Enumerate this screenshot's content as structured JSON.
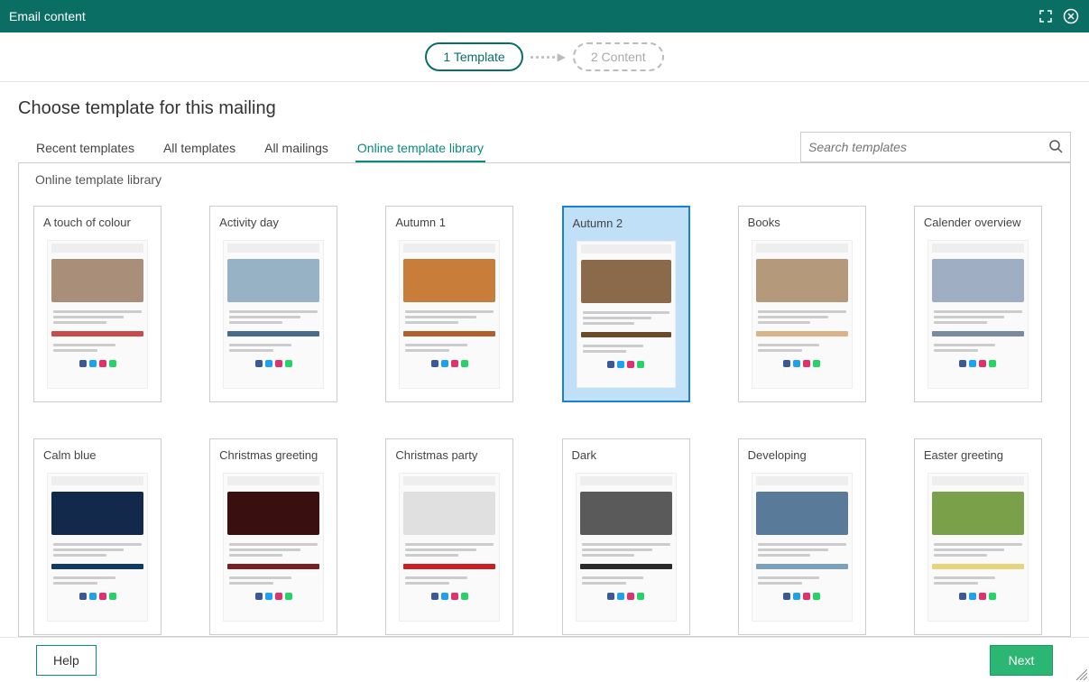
{
  "titlebar": {
    "title": "Email content"
  },
  "wizard": {
    "step1": "1 Template",
    "step2": "2 Content"
  },
  "heading": "Choose template for this mailing",
  "tabs": [
    "Recent templates",
    "All templates",
    "All mailings",
    "Online template library"
  ],
  "active_tab_index": 3,
  "search": {
    "placeholder": "Search templates"
  },
  "panel": {
    "header": "Online template library"
  },
  "templates": [
    {
      "name": "A touch of colour",
      "accent": "#c84b4b",
      "img": "#a98f7a",
      "selected": false
    },
    {
      "name": "Activity day",
      "accent": "#4a6a8a",
      "img": "#97b2c4",
      "selected": false
    },
    {
      "name": "Autumn 1",
      "accent": "#b25f2b",
      "img": "#c97d3a",
      "selected": false
    },
    {
      "name": "Autumn 2",
      "accent": "#6b4a2a",
      "img": "#8a6a4a",
      "selected": true
    },
    {
      "name": "Books",
      "accent": "#d9b48a",
      "img": "#b49a7a",
      "selected": false
    },
    {
      "name": "Calender overview",
      "accent": "#7a8aa0",
      "img": "#9faec2",
      "selected": false
    },
    {
      "name": "Calm blue",
      "accent": "#0d3b66",
      "img": "#13294b",
      "selected": false
    },
    {
      "name": "Christmas greeting",
      "accent": "#7a1f1f",
      "img": "#3a0f0f",
      "selected": false
    },
    {
      "name": "Christmas party",
      "accent": "#c82020",
      "img": "#e0e0e0",
      "selected": false
    },
    {
      "name": "Dark",
      "accent": "#2a2a2a",
      "img": "#5a5a5a",
      "selected": false
    },
    {
      "name": "Developing",
      "accent": "#7aa0c0",
      "img": "#5a7a9a",
      "selected": false
    },
    {
      "name": "Easter greeting",
      "accent": "#e8d27a",
      "img": "#7aa04a",
      "selected": false
    }
  ],
  "footer": {
    "help": "Help",
    "next": "Next"
  }
}
